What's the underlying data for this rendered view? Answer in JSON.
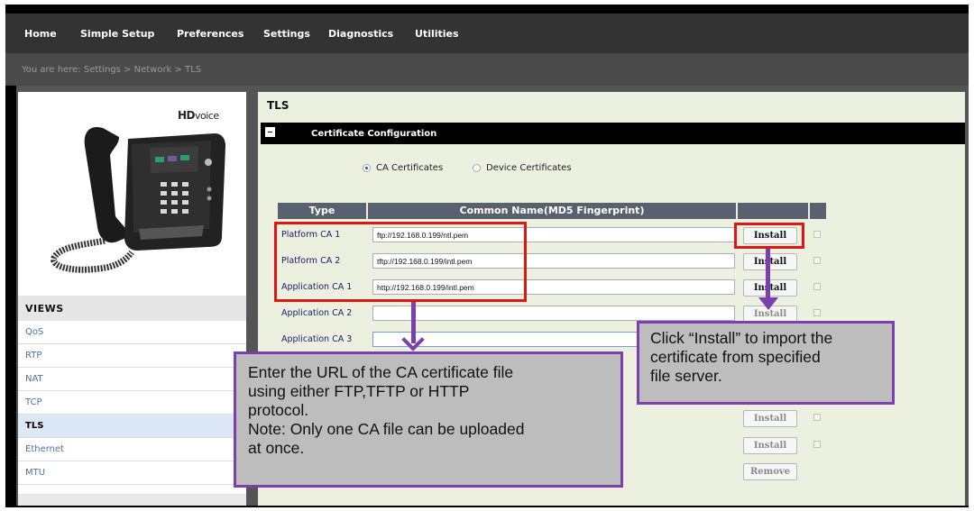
{
  "nav": [
    "Home",
    "Simple Setup",
    "Preferences",
    "Settings",
    "Diagnostics",
    "Utilities"
  ],
  "breadcrumb": "You are here: Settings > Network > TLS",
  "sidebar": {
    "logo_bold": "HD",
    "logo_rest": "voice",
    "views_title": "VIEWS",
    "items": [
      "QoS",
      "RTP",
      "NAT",
      "TCP",
      "TLS",
      "Ethernet",
      "MTU"
    ],
    "active": "TLS"
  },
  "page_title": "TLS",
  "section_title": "Certificate Configuration",
  "radio_options": [
    {
      "label": "CA Certificates",
      "selected": true
    },
    {
      "label": "Device Certificates",
      "selected": false
    }
  ],
  "table": {
    "headers": [
      "Type",
      "Common Name(MD5 Fingerprint)"
    ],
    "rows": [
      {
        "type": "Platform CA 1",
        "url": "ftp://192.168.0.199/ntl.pem",
        "button": "Install"
      },
      {
        "type": "Platform CA 2",
        "url": "tftp://192.168.0.199/intl.pem",
        "button": "Install"
      },
      {
        "type": "Application CA 1",
        "url": "http://192.168.0.199/intl.pem",
        "button": "Install"
      },
      {
        "type": "Application CA 2",
        "url": "",
        "button": "Install"
      },
      {
        "type": "Application CA 3",
        "url": "",
        "button": "Install"
      }
    ],
    "extra_buttons": [
      "Install",
      "Install"
    ],
    "remove_label": "Remove"
  },
  "callouts": {
    "left": [
      "Enter the URL of the CA certificate file",
      "using either FTP,TFTP or HTTP",
      "protocol.",
      "Note: Only one CA file can be uploaded",
      "at once."
    ],
    "right": [
      "Click “Install” to import the",
      "certificate from specified",
      "file server."
    ]
  },
  "colors": {
    "highlight": "#e31414",
    "callout_border": "#7e3fae",
    "callout_fill": "#bdbdbd",
    "content_bg": "#ecf0df"
  }
}
